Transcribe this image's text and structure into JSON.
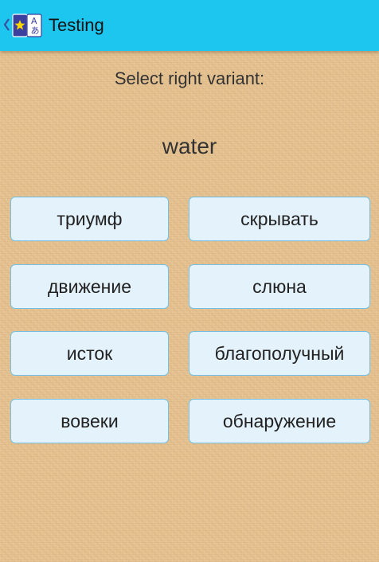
{
  "header": {
    "title": "Testing",
    "back_icon": "chevron-left-icon",
    "app_icon": "ab-book-icon",
    "bar_color": "#1cc6ef"
  },
  "quiz": {
    "prompt": "Select right variant:",
    "word": "water",
    "options": [
      "триумф",
      "скрывать",
      "движение",
      "слюна",
      "исток",
      "благополучный",
      "вовеки",
      "обнаружение"
    ]
  }
}
